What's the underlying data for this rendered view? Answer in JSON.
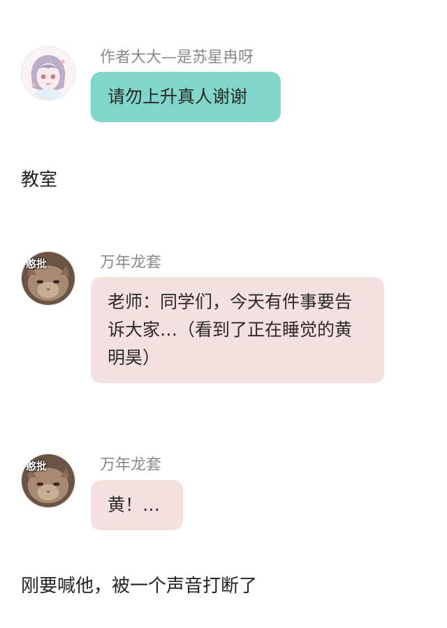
{
  "messages": [
    {
      "sender": "作者大大—是苏星冉呀",
      "text": "请勿上升真人谢谢",
      "avatar_icon": "anime-girl-avatar",
      "bubble_color": "#7fd6c9"
    },
    {
      "sender": "万年龙套",
      "text": "老师：同学们，今天有件事要告诉大家…（看到了正在睡觉的黄明昊）",
      "avatar_icon": "cat-meme-avatar",
      "avatar_text": "憨批",
      "bubble_color": "#f4e0e1"
    },
    {
      "sender": "万年龙套",
      "text": "黄！…",
      "avatar_icon": "cat-meme-avatar",
      "avatar_text": "憨批",
      "bubble_color": "#f4e0e1"
    }
  ],
  "narration": [
    "教室",
    "刚要喊他，被一个声音打断了"
  ]
}
